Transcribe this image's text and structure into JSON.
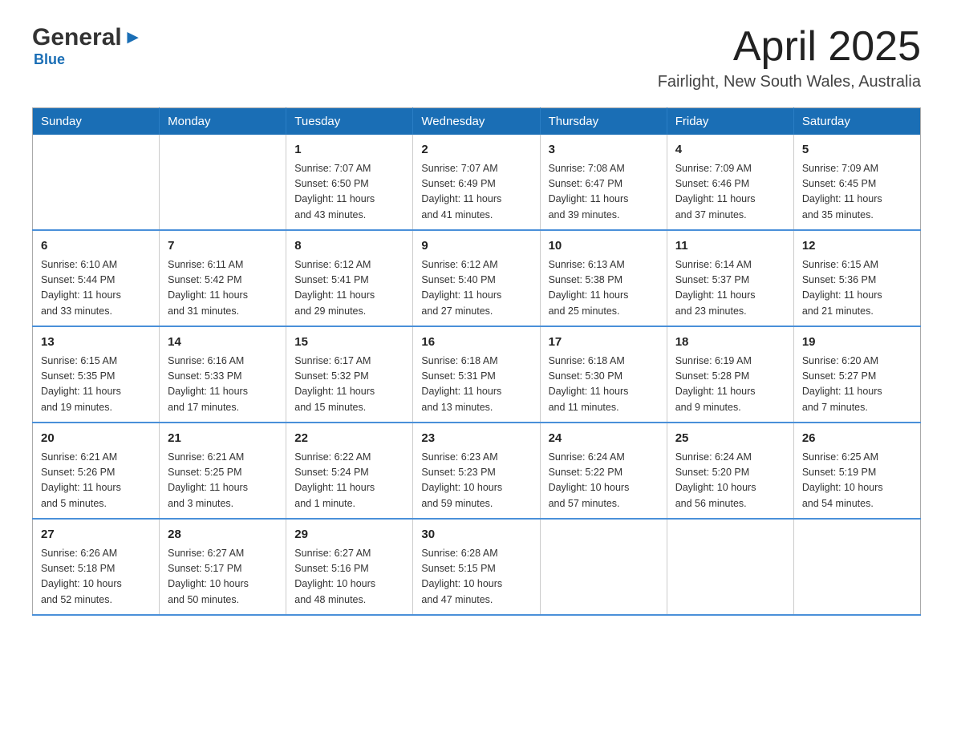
{
  "header": {
    "logo_general": "General",
    "logo_arrow": "▶",
    "logo_blue": "Blue",
    "month_title": "April 2025",
    "location": "Fairlight, New South Wales, Australia"
  },
  "weekdays": [
    "Sunday",
    "Monday",
    "Tuesday",
    "Wednesday",
    "Thursday",
    "Friday",
    "Saturday"
  ],
  "weeks": [
    [
      {
        "day": "",
        "info": ""
      },
      {
        "day": "",
        "info": ""
      },
      {
        "day": "1",
        "info": "Sunrise: 7:07 AM\nSunset: 6:50 PM\nDaylight: 11 hours\nand 43 minutes."
      },
      {
        "day": "2",
        "info": "Sunrise: 7:07 AM\nSunset: 6:49 PM\nDaylight: 11 hours\nand 41 minutes."
      },
      {
        "day": "3",
        "info": "Sunrise: 7:08 AM\nSunset: 6:47 PM\nDaylight: 11 hours\nand 39 minutes."
      },
      {
        "day": "4",
        "info": "Sunrise: 7:09 AM\nSunset: 6:46 PM\nDaylight: 11 hours\nand 37 minutes."
      },
      {
        "day": "5",
        "info": "Sunrise: 7:09 AM\nSunset: 6:45 PM\nDaylight: 11 hours\nand 35 minutes."
      }
    ],
    [
      {
        "day": "6",
        "info": "Sunrise: 6:10 AM\nSunset: 5:44 PM\nDaylight: 11 hours\nand 33 minutes."
      },
      {
        "day": "7",
        "info": "Sunrise: 6:11 AM\nSunset: 5:42 PM\nDaylight: 11 hours\nand 31 minutes."
      },
      {
        "day": "8",
        "info": "Sunrise: 6:12 AM\nSunset: 5:41 PM\nDaylight: 11 hours\nand 29 minutes."
      },
      {
        "day": "9",
        "info": "Sunrise: 6:12 AM\nSunset: 5:40 PM\nDaylight: 11 hours\nand 27 minutes."
      },
      {
        "day": "10",
        "info": "Sunrise: 6:13 AM\nSunset: 5:38 PM\nDaylight: 11 hours\nand 25 minutes."
      },
      {
        "day": "11",
        "info": "Sunrise: 6:14 AM\nSunset: 5:37 PM\nDaylight: 11 hours\nand 23 minutes."
      },
      {
        "day": "12",
        "info": "Sunrise: 6:15 AM\nSunset: 5:36 PM\nDaylight: 11 hours\nand 21 minutes."
      }
    ],
    [
      {
        "day": "13",
        "info": "Sunrise: 6:15 AM\nSunset: 5:35 PM\nDaylight: 11 hours\nand 19 minutes."
      },
      {
        "day": "14",
        "info": "Sunrise: 6:16 AM\nSunset: 5:33 PM\nDaylight: 11 hours\nand 17 minutes."
      },
      {
        "day": "15",
        "info": "Sunrise: 6:17 AM\nSunset: 5:32 PM\nDaylight: 11 hours\nand 15 minutes."
      },
      {
        "day": "16",
        "info": "Sunrise: 6:18 AM\nSunset: 5:31 PM\nDaylight: 11 hours\nand 13 minutes."
      },
      {
        "day": "17",
        "info": "Sunrise: 6:18 AM\nSunset: 5:30 PM\nDaylight: 11 hours\nand 11 minutes."
      },
      {
        "day": "18",
        "info": "Sunrise: 6:19 AM\nSunset: 5:28 PM\nDaylight: 11 hours\nand 9 minutes."
      },
      {
        "day": "19",
        "info": "Sunrise: 6:20 AM\nSunset: 5:27 PM\nDaylight: 11 hours\nand 7 minutes."
      }
    ],
    [
      {
        "day": "20",
        "info": "Sunrise: 6:21 AM\nSunset: 5:26 PM\nDaylight: 11 hours\nand 5 minutes."
      },
      {
        "day": "21",
        "info": "Sunrise: 6:21 AM\nSunset: 5:25 PM\nDaylight: 11 hours\nand 3 minutes."
      },
      {
        "day": "22",
        "info": "Sunrise: 6:22 AM\nSunset: 5:24 PM\nDaylight: 11 hours\nand 1 minute."
      },
      {
        "day": "23",
        "info": "Sunrise: 6:23 AM\nSunset: 5:23 PM\nDaylight: 10 hours\nand 59 minutes."
      },
      {
        "day": "24",
        "info": "Sunrise: 6:24 AM\nSunset: 5:22 PM\nDaylight: 10 hours\nand 57 minutes."
      },
      {
        "day": "25",
        "info": "Sunrise: 6:24 AM\nSunset: 5:20 PM\nDaylight: 10 hours\nand 56 minutes."
      },
      {
        "day": "26",
        "info": "Sunrise: 6:25 AM\nSunset: 5:19 PM\nDaylight: 10 hours\nand 54 minutes."
      }
    ],
    [
      {
        "day": "27",
        "info": "Sunrise: 6:26 AM\nSunset: 5:18 PM\nDaylight: 10 hours\nand 52 minutes."
      },
      {
        "day": "28",
        "info": "Sunrise: 6:27 AM\nSunset: 5:17 PM\nDaylight: 10 hours\nand 50 minutes."
      },
      {
        "day": "29",
        "info": "Sunrise: 6:27 AM\nSunset: 5:16 PM\nDaylight: 10 hours\nand 48 minutes."
      },
      {
        "day": "30",
        "info": "Sunrise: 6:28 AM\nSunset: 5:15 PM\nDaylight: 10 hours\nand 47 minutes."
      },
      {
        "day": "",
        "info": ""
      },
      {
        "day": "",
        "info": ""
      },
      {
        "day": "",
        "info": ""
      }
    ]
  ]
}
